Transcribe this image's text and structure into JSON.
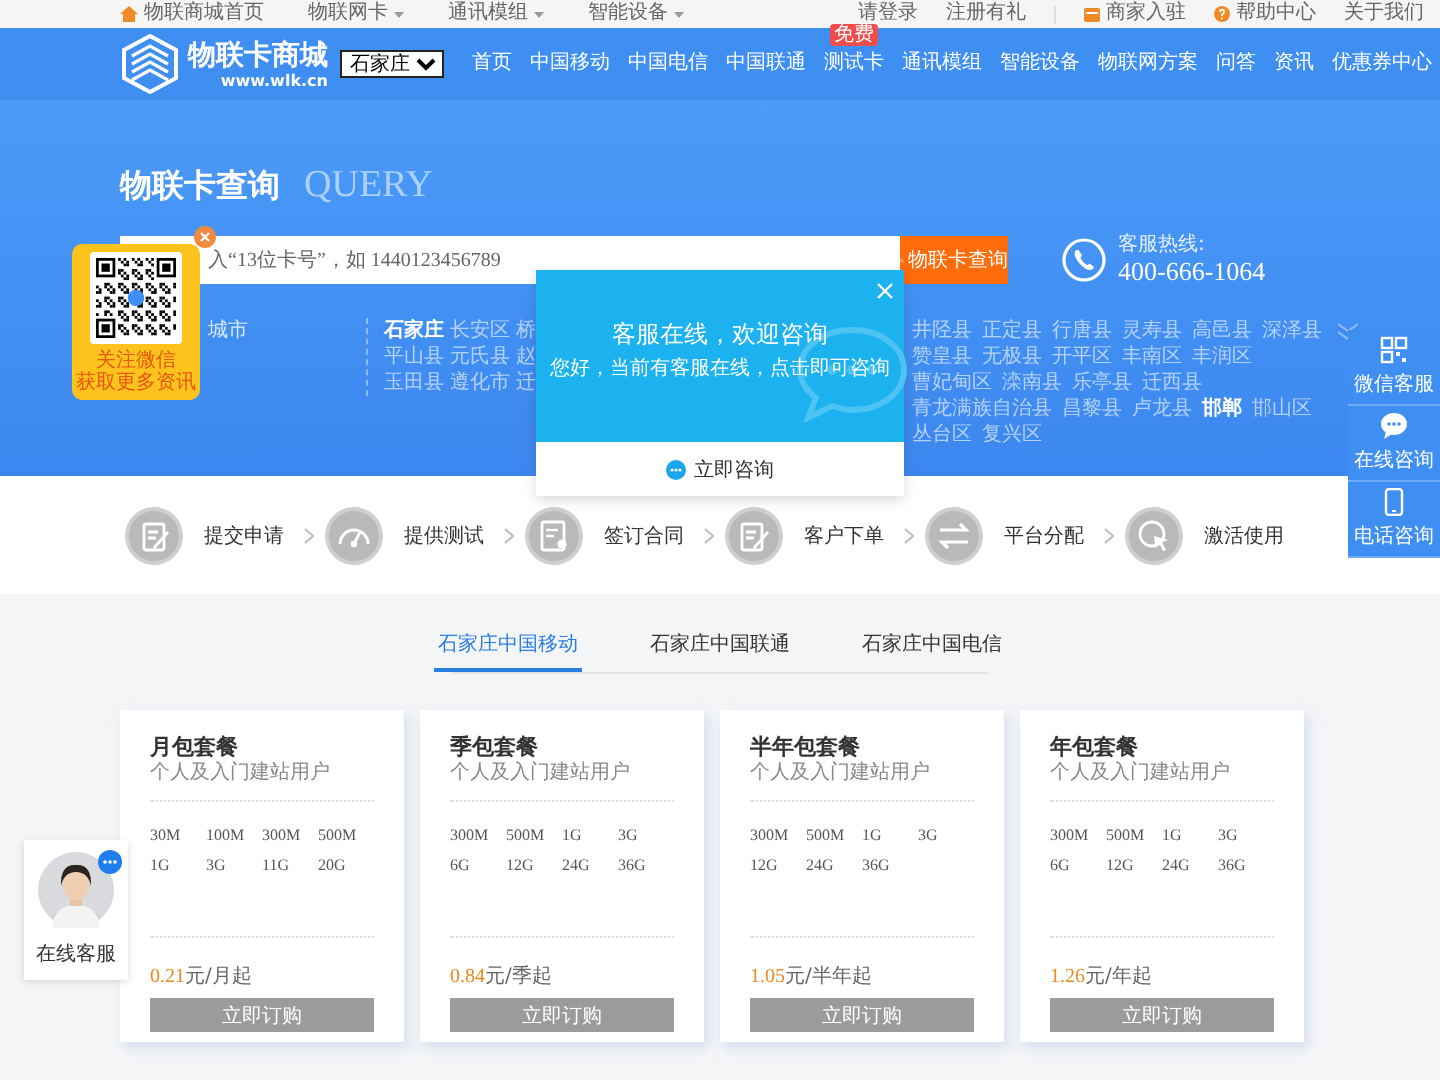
{
  "top_bar": {
    "left": [
      {
        "label": "物联商城首页",
        "kind": "home"
      },
      {
        "label": "物联网卡",
        "kind": "menu"
      },
      {
        "label": "通讯模组",
        "kind": "menu"
      },
      {
        "label": "智能设备",
        "kind": "menu"
      }
    ],
    "right": [
      {
        "label": "请登录",
        "kind": "link"
      },
      {
        "label": "注册有礼",
        "kind": "link"
      },
      {
        "label": "商家入驻",
        "kind": "shop"
      },
      {
        "label": "帮助中心",
        "kind": "help"
      },
      {
        "label": "关于我们",
        "kind": "link"
      }
    ]
  },
  "header": {
    "logo": {
      "name": "物联卡商城",
      "domain": "www.wlk.cn"
    },
    "city_select": "石家庄",
    "nav": [
      {
        "label": "首页"
      },
      {
        "label": "中国移动"
      },
      {
        "label": "中国电信"
      },
      {
        "label": "中国联通"
      },
      {
        "label": "测试卡",
        "badge": "免费"
      },
      {
        "label": "通讯模组"
      },
      {
        "label": "智能设备"
      },
      {
        "label": "物联网方案"
      },
      {
        "label": "问答"
      },
      {
        "label": "资讯"
      },
      {
        "label": "优惠券中心"
      }
    ]
  },
  "hero": {
    "title": "物联卡查询",
    "title_backdrop": "QUERY",
    "search": {
      "placeholder": "入“13位卡号”，如 1440123456789",
      "button": "物联卡查询"
    },
    "hotline": {
      "label": "客服热线:",
      "number": "400-666-1064"
    },
    "city_filter": {
      "label": "城市",
      "cities_left": [
        {
          "name": "石家庄",
          "kind": "city"
        },
        {
          "name": "长安区",
          "kind": "district"
        },
        {
          "name": "桥",
          "kind": "district"
        },
        {
          "name": "平山县",
          "kind": "district"
        },
        {
          "name": "元氏县",
          "kind": "district"
        },
        {
          "name": "赵",
          "kind": "district"
        },
        {
          "name": "玉田县",
          "kind": "district"
        },
        {
          "name": "遵化市",
          "kind": "district"
        },
        {
          "name": "迁",
          "kind": "district"
        }
      ],
      "cities_right": [
        {
          "name": "井陉县",
          "kind": "district"
        },
        {
          "name": "正定县",
          "kind": "district"
        },
        {
          "name": "行唐县",
          "kind": "district"
        },
        {
          "name": "灵寿县",
          "kind": "district"
        },
        {
          "name": "高邑县",
          "kind": "district"
        },
        {
          "name": "深泽县",
          "kind": "district"
        },
        {
          "name": "赞皇县",
          "kind": "district"
        },
        {
          "name": "无极县",
          "kind": "district"
        },
        {
          "name": "开平区",
          "kind": "district"
        },
        {
          "name": "丰南区",
          "kind": "district"
        },
        {
          "name": "丰润区",
          "kind": "district"
        },
        {
          "name": "曹妃甸区",
          "kind": "district"
        },
        {
          "name": "滦南县",
          "kind": "district"
        },
        {
          "name": "乐亭县",
          "kind": "district"
        },
        {
          "name": "迁西县",
          "kind": "district"
        },
        {
          "name": "青龙满族自治县",
          "kind": "district"
        },
        {
          "name": "昌黎县",
          "kind": "district"
        },
        {
          "name": "卢龙县",
          "kind": "district"
        },
        {
          "name": "邯郸",
          "kind": "city"
        },
        {
          "name": "邯山区",
          "kind": "district"
        },
        {
          "name": "丛台区",
          "kind": "district"
        },
        {
          "name": "复兴区",
          "kind": "district"
        }
      ]
    }
  },
  "steps": [
    {
      "label": "提交申请"
    },
    {
      "label": "提供测试"
    },
    {
      "label": "签订合同"
    },
    {
      "label": "客户下单"
    },
    {
      "label": "平台分配"
    },
    {
      "label": "激活使用"
    }
  ],
  "tabs": [
    {
      "label": "石家庄中国移动",
      "selected": true
    },
    {
      "label": "石家庄中国联通",
      "selected": false
    },
    {
      "label": "石家庄中国电信",
      "selected": false
    }
  ],
  "plans": [
    {
      "title": "月包套餐",
      "subtitle": "个人及入门建站用户",
      "specs": [
        "30M",
        "100M",
        "300M",
        "500M",
        "1G",
        "3G",
        "11G",
        "20G"
      ],
      "price": "0.21",
      "unit": "元/月起",
      "button": "立即订购"
    },
    {
      "title": "季包套餐",
      "subtitle": "个人及入门建站用户",
      "specs": [
        "300M",
        "500M",
        "1G",
        "3G",
        "6G",
        "12G",
        "24G",
        "36G"
      ],
      "price": "0.84",
      "unit": "元/季起",
      "button": "立即订购"
    },
    {
      "title": "半年包套餐",
      "subtitle": "个人及入门建站用户",
      "specs": [
        "300M",
        "500M",
        "1G",
        "3G",
        "12G",
        "24G",
        "36G"
      ],
      "price": "1.05",
      "unit": "元/半年起",
      "button": "立即订购"
    },
    {
      "title": "年包套餐",
      "subtitle": "个人及入门建站用户",
      "specs": [
        "300M",
        "500M",
        "1G",
        "3G",
        "6G",
        "12G",
        "24G",
        "36G"
      ],
      "price": "1.26",
      "unit": "元/年起",
      "button": "立即订购"
    }
  ],
  "qr_popup": {
    "lines": [
      "关注微信",
      "获取更多资讯"
    ]
  },
  "chat_popup": {
    "title": "客服在线，欢迎咨询",
    "message": "您好，当前有客服在线，点击即可咨询",
    "button": "立即咨询"
  },
  "side_tools": [
    {
      "label": "微信客服"
    },
    {
      "label": "在线咨询"
    },
    {
      "label": "电话咨询"
    }
  ],
  "service_badge": {
    "label": "在线客服"
  }
}
